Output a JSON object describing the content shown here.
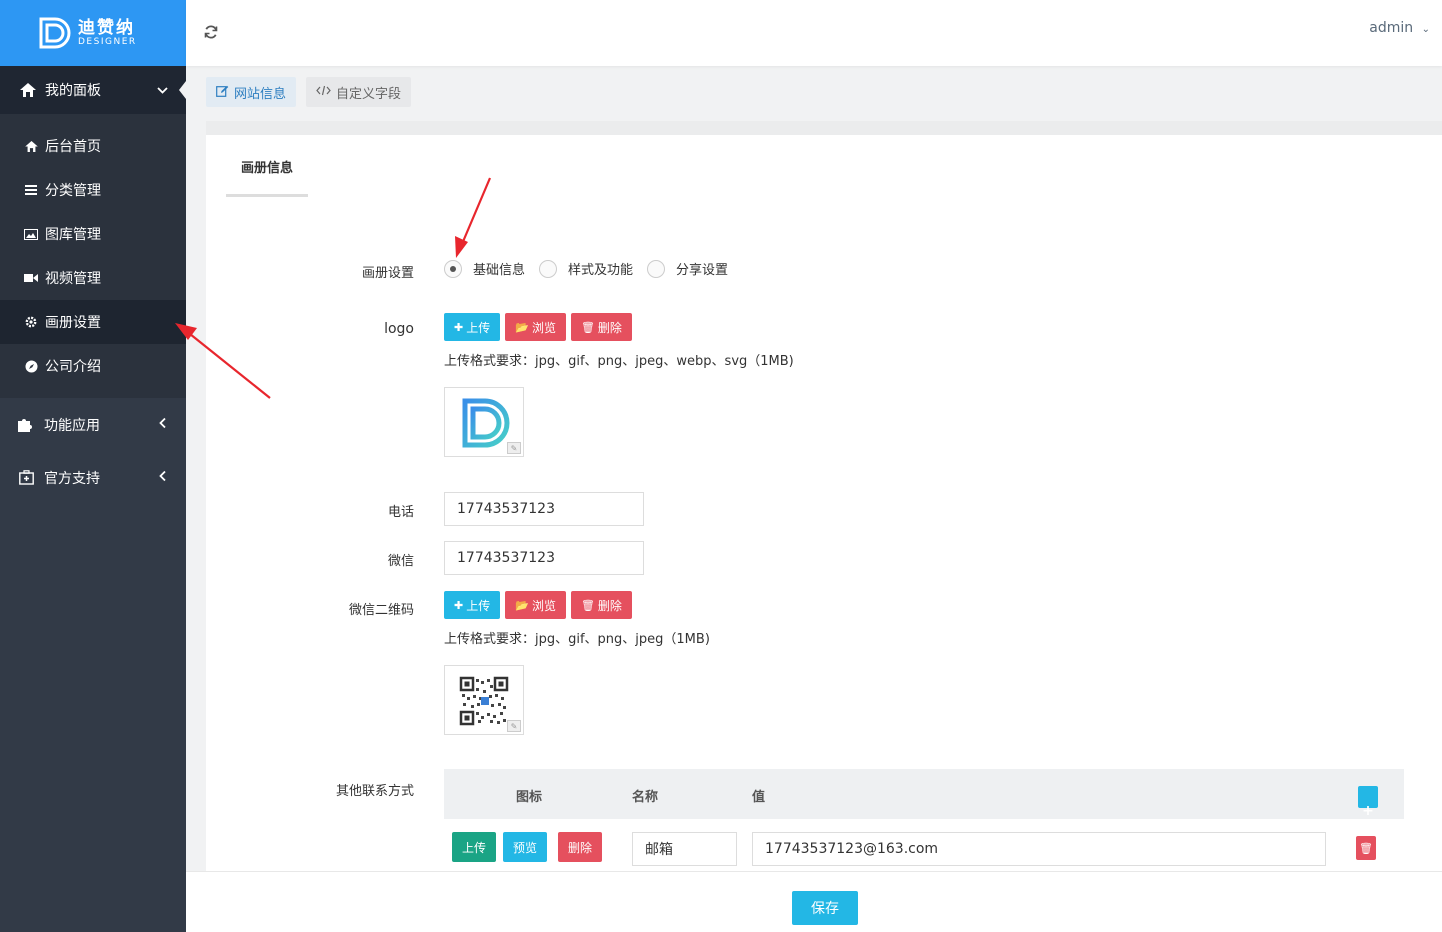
{
  "brand": {
    "name_cn": "迪赞纳",
    "name_en": "DESIGNER"
  },
  "topbar": {
    "user": "admin"
  },
  "sidebar": {
    "group_main": "我的面板",
    "items": [
      {
        "label": "后台首页",
        "icon": "home-icon"
      },
      {
        "label": "分类管理",
        "icon": "list-icon"
      },
      {
        "label": "图库管理",
        "icon": "image-icon"
      },
      {
        "label": "视频管理",
        "icon": "video-icon"
      },
      {
        "label": "画册设置",
        "icon": "gear-icon"
      },
      {
        "label": "公司介绍",
        "icon": "compass-icon"
      }
    ],
    "group_apps": "功能应用",
    "group_support": "官方支持"
  },
  "tabs": [
    {
      "label": "网站信息"
    },
    {
      "label": "自定义字段"
    }
  ],
  "subtab": "画册信息",
  "form": {
    "album_setting_label": "画册设置",
    "radio_options": [
      "基础信息",
      "样式及功能",
      "分享设置"
    ],
    "selected_option": "基础信息",
    "logo_label": "logo",
    "upload": "上传",
    "browse": "浏览",
    "delete": "删除",
    "logo_hint": "上传格式要求：jpg、gif、png、jpeg、webp、svg（1MB)",
    "phone_label": "电话",
    "phone_value": "17743537123",
    "wechat_label": "微信",
    "wechat_value": "17743537123",
    "qr_label": "微信二维码",
    "qr_hint": "上传格式要求：jpg、gif、png、jpeg（1MB)",
    "other_contact_label": "其他联系方式",
    "table_headers": {
      "icon": "图标",
      "name": "名称",
      "value": "值"
    },
    "row": {
      "upload": "上传",
      "preview": "预览",
      "delete": "删除",
      "name": "邮箱",
      "value": "17743537123@163.com"
    }
  },
  "footer": {
    "save": "保存"
  },
  "colors": {
    "primary": "#23b7e5",
    "danger": "#e5505e",
    "success": "#1aa485",
    "sidebar": "#323a47",
    "brand": "#2d97f3"
  }
}
